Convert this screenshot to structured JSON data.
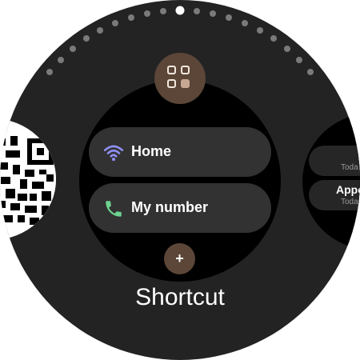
{
  "screen": {
    "title": "Shortcut"
  },
  "left_tile": {
    "icon": "qr-code-icon"
  },
  "right_tile": {
    "items": [
      {
        "title": "",
        "subtitle": "Toda"
      },
      {
        "title": "Appo",
        "subtitle": "Toda"
      }
    ]
  },
  "main_tile": {
    "app_icon": "app-grid-icon",
    "shortcuts": [
      {
        "label": "Home",
        "icon": "wifi-icon",
        "icon_color": "#8f8ff5"
      },
      {
        "label": "My number",
        "icon": "phone-icon",
        "icon_color": "#6dd38f"
      }
    ],
    "add_button": {
      "label": "+",
      "icon": "add-icon"
    }
  },
  "page_indicator": {
    "total": 19,
    "active_index": 0
  },
  "colors": {
    "face_background": "#232323",
    "tile_background": "#000000",
    "pill_background": "#323232",
    "accent_brown": "#5b4638",
    "dot_inactive": "#7a7a7a",
    "dot_active": "#ffffff"
  }
}
